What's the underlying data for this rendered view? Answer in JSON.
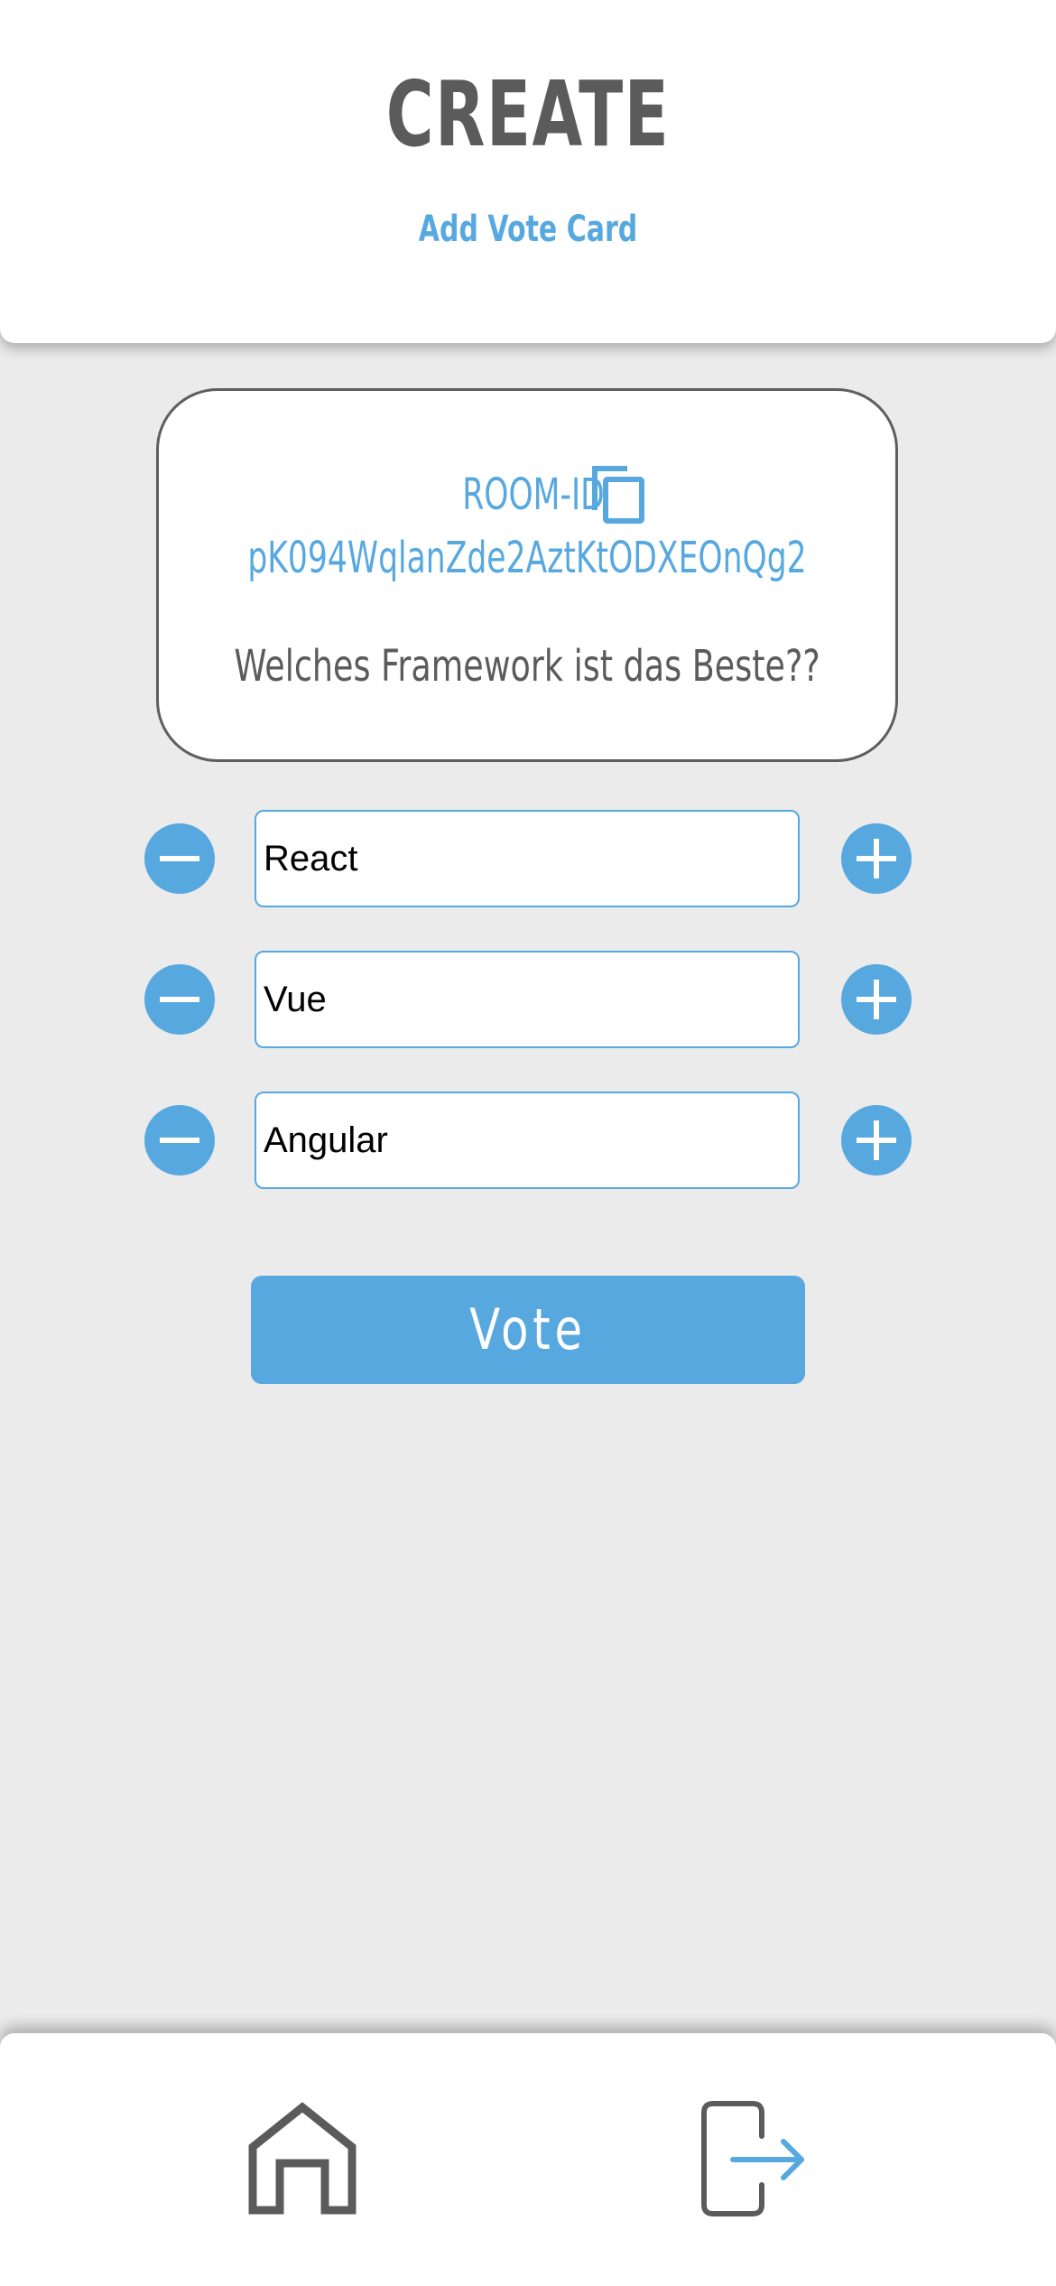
{
  "header": {
    "title": "CREATE",
    "subtitle": "Add Vote Card"
  },
  "room": {
    "id_label": "ROOM-ID",
    "id_value": "pK094WqlanZde2AztKtODXEOnQg2",
    "copy_icon": "copy-icon",
    "question": "Welches Framework ist das Beste??"
  },
  "options": [
    {
      "value": "React"
    },
    {
      "value": "Vue"
    },
    {
      "value": "Angular"
    }
  ],
  "vote_button": {
    "label": "Vote"
  },
  "nav": {
    "home_icon": "home-icon",
    "logout_icon": "logout-icon"
  },
  "colors": {
    "accent": "#58a8e0",
    "text_dark": "#5b5b5b",
    "background": "#ebebeb",
    "surface": "#ffffff"
  }
}
